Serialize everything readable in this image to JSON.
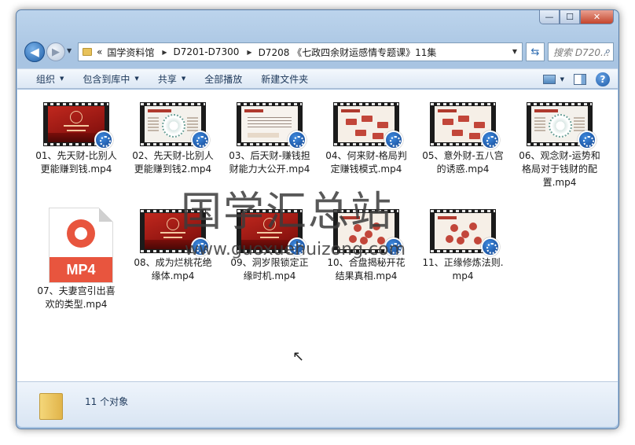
{
  "window": {
    "minimize_glyph": "—",
    "maximize_glyph": "☐",
    "close_glyph": "✕"
  },
  "address": {
    "overflow_glyph": "«",
    "crumbs": [
      "国学资料馆",
      "D7201-D7300",
      "D7208 《七政四余财运感情专题课》11集"
    ],
    "search_placeholder": "搜索 D720..."
  },
  "toolbar": {
    "organize": "组织",
    "include_library": "包含到库中",
    "share": "共享",
    "play_all": "全部播放",
    "new_folder": "新建文件夹"
  },
  "files": [
    {
      "name": "01、先天财-比别人更能赚到钱.mp4",
      "thumb": "red"
    },
    {
      "name": "02、先天财-比别人更能赚到钱2.mp4",
      "thumb": "chart"
    },
    {
      "name": "03、后天财-赚钱担财能力大公开.mp4",
      "thumb": "text"
    },
    {
      "name": "04、何来财-格局判定赚钱模式.mp4",
      "thumb": "boxes"
    },
    {
      "name": "05、意外财-五八宫的诱惑.mp4",
      "thumb": "boxes"
    },
    {
      "name": "06、观念财-运势和格局对于钱财的配置.mp4",
      "thumb": "chart"
    },
    {
      "name": "07、夫妻宫引出喜欢的类型.mp4",
      "thumb": "mp4"
    },
    {
      "name": "08、成为烂桃花绝缘体.mp4",
      "thumb": "red"
    },
    {
      "name": "09、洞岁限锁定正缘时机.mp4",
      "thumb": "red"
    },
    {
      "name": "10、合盘揭秘开花结果真相.mp4",
      "thumb": "dots"
    },
    {
      "name": "11、正缘修炼法则.mp4",
      "thumb": "dots"
    }
  ],
  "mp4_icon_label": "MP4",
  "watermark": {
    "text": "国学汇总站",
    "url": "www.guoxuehuizong.com"
  },
  "status": {
    "count": "11 个对象"
  }
}
